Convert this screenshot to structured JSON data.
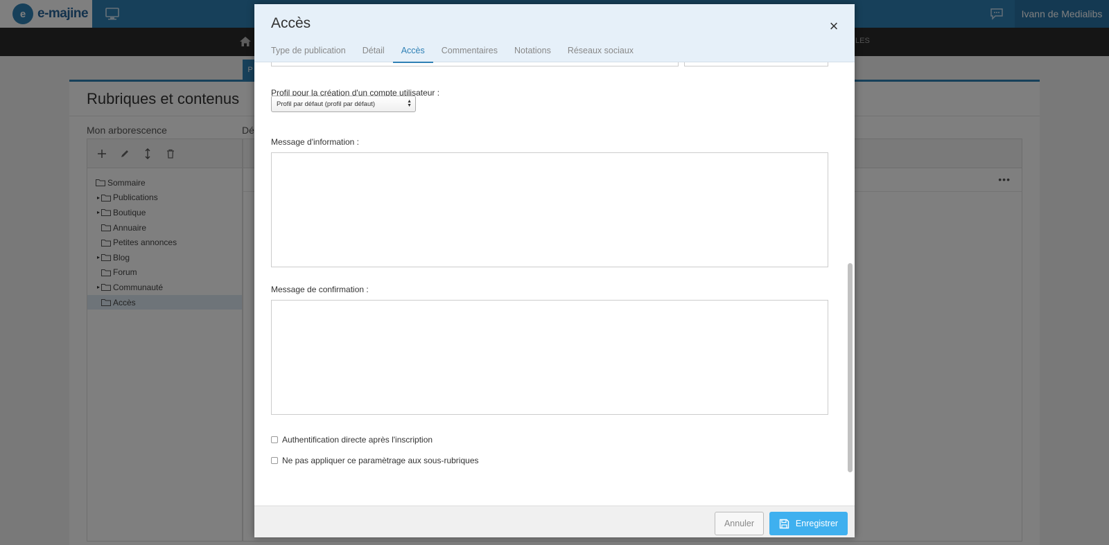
{
  "app": {
    "logo_letter": "e",
    "logo_text": "e-majine",
    "user_name": "Ivann de Medialibs",
    "nav_tail": "LES"
  },
  "background": {
    "blue_tab_text": "P",
    "page_title": "Rubriques et contenus",
    "tree_label": "Mon arborescence",
    "detail_label": "Dé",
    "tree_items": [
      {
        "label": "Sommaire",
        "caret": "",
        "indent": 0
      },
      {
        "label": "Publications",
        "caret": "▸",
        "indent": 1
      },
      {
        "label": "Boutique",
        "caret": "▸",
        "indent": 1
      },
      {
        "label": "Annuaire",
        "caret": "",
        "indent": 1
      },
      {
        "label": "Petites annonces",
        "caret": "",
        "indent": 1
      },
      {
        "label": "Blog",
        "caret": "▸",
        "indent": 1
      },
      {
        "label": "Forum",
        "caret": "",
        "indent": 1
      },
      {
        "label": "Communauté",
        "caret": "▸",
        "indent": 1
      },
      {
        "label": "Accès",
        "caret": "",
        "indent": 1,
        "selected": true
      }
    ],
    "more_label": "•••"
  },
  "modal": {
    "title": "Accès",
    "close_label": "×",
    "tabs": [
      {
        "label": "Type de publication",
        "active": false
      },
      {
        "label": "Détail",
        "active": false
      },
      {
        "label": "Accès",
        "active": true
      },
      {
        "label": "Commentaires",
        "active": false
      },
      {
        "label": "Notations",
        "active": false
      },
      {
        "label": "Réseaux sociaux",
        "active": false
      }
    ],
    "profile_label": "Profil pour la création d'un compte utilisateur   :",
    "profile_value": "Profil par défaut (profil par défaut)",
    "info_label": "Message d'information   :",
    "confirm_label": "Message de confirmation   :",
    "check_auth": "Authentification directe après l'inscription",
    "check_sub": "Ne pas appliquer ce paramètrage aux sous-rubriques",
    "cancel_label": "Annuler",
    "save_label": "Enregistrer"
  },
  "colors": {
    "accent": "#2f80b5",
    "save_button": "#3fb0ef",
    "header_bg": "#e6f0f9"
  }
}
